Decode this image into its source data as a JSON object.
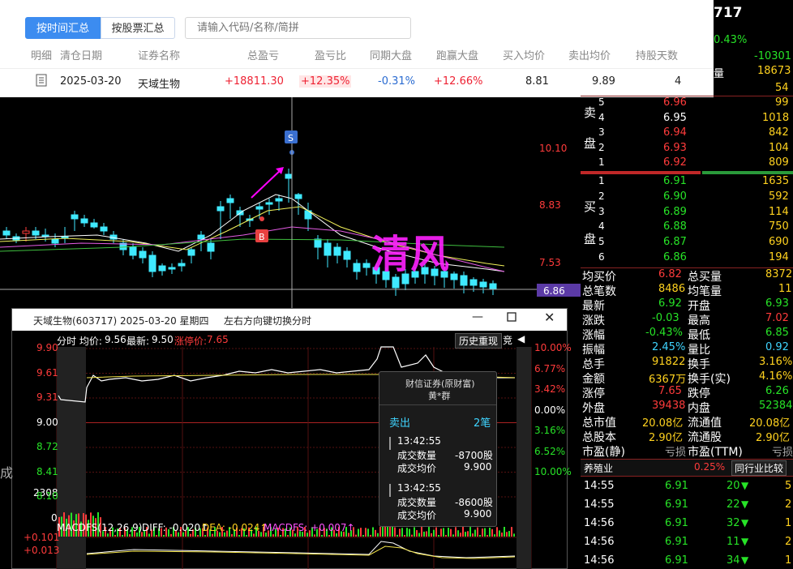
{
  "summary": {
    "tab_by_time": "按时间汇总",
    "tab_by_stock": "按股票汇总",
    "search_placeholder": "请输入代码/名称/简拼",
    "headers": [
      "明细",
      "清仓日期",
      "证券名称",
      "总盈亏",
      "盈亏比",
      "同期大盘",
      "跑赢大盘",
      "买入均价",
      "卖出均价",
      "持股天数"
    ],
    "row": {
      "date": "2025-03-20",
      "name": "天域生物",
      "total_pl": "+18811.30",
      "pl_ratio": "+12.35%",
      "market": "-0.31%",
      "beat": "+12.66%",
      "buy_avg": "8.81",
      "sell_avg": "9.89",
      "days": "4"
    }
  },
  "kline": {
    "price_labels": [
      "10.10",
      "8.83",
      "7.53"
    ],
    "current_price": "6.86",
    "marker_s": "S",
    "marker_b": "B",
    "watermark": "清风",
    "colors": {
      "up": "#ff3b3b",
      "down": "#3fe9ff",
      "ma5": "#ffffff",
      "ma10": "#f2f25a",
      "ma20": "#e65ce6",
      "ma60": "#3fbf3f",
      "accent": "#ff00ff"
    }
  },
  "quote": {
    "code_partial": "717",
    "change_partial": "0.43%",
    "vol_row1": "-10301",
    "vol_row2": "18673",
    "vol_label": "量",
    "vol_row3": "54",
    "sell_label": [
      "卖",
      "盘"
    ],
    "buy_label": [
      "买",
      "盘"
    ],
    "asks": [
      {
        "level": "5",
        "price": "6.96",
        "vol": "99"
      },
      {
        "level": "4",
        "price": "6.95",
        "vol": "1018"
      },
      {
        "level": "3",
        "price": "6.94",
        "vol": "842"
      },
      {
        "level": "2",
        "price": "6.93",
        "vol": "104"
      },
      {
        "level": "1",
        "price": "6.92",
        "vol": "809"
      }
    ],
    "bids": [
      {
        "level": "1",
        "price": "6.91",
        "vol": "1635"
      },
      {
        "level": "2",
        "price": "6.90",
        "vol": "592"
      },
      {
        "level": "3",
        "price": "6.89",
        "vol": "114"
      },
      {
        "level": "4",
        "price": "6.88",
        "vol": "750"
      },
      {
        "level": "5",
        "price": "6.87",
        "vol": "690"
      },
      {
        "level": "6",
        "price": "6.86",
        "vol": "194"
      }
    ],
    "stats": [
      {
        "l1": "均买价",
        "v1": "6.82",
        "c1": "red",
        "l2": "总买量",
        "v2": "8372",
        "c2": "yellow"
      },
      {
        "l1": "总笔数",
        "v1": "8486",
        "c1": "yellow",
        "l2": "均笔量",
        "v2": "11",
        "c2": "yellow"
      },
      {
        "l1": "最新",
        "v1": "6.92",
        "c1": "green",
        "l2": "开盘",
        "v2": "6.93",
        "c2": "green"
      },
      {
        "l1": "涨跌",
        "v1": "-0.03",
        "c1": "green",
        "l2": "最高",
        "v2": "7.02",
        "c2": "red"
      },
      {
        "l1": "涨幅",
        "v1": "-0.43%",
        "c1": "green",
        "l2": "最低",
        "v2": "6.85",
        "c2": "green"
      },
      {
        "l1": "振幅",
        "v1": "2.45%",
        "c1": "cyan",
        "l2": "量比",
        "v2": "0.92",
        "c2": "cyan"
      },
      {
        "l1": "总手",
        "v1": "91822",
        "c1": "yellow",
        "l2": "换手",
        "v2": "3.16%",
        "c2": "yellow"
      },
      {
        "l1": "金额",
        "v1": "6367万",
        "c1": "yellow",
        "l2": "换手(实)",
        "v2": "4.16%",
        "c2": "yellow"
      },
      {
        "l1": "涨停",
        "v1": "7.65",
        "c1": "red",
        "l2": "跌停",
        "v2": "6.26",
        "c2": "green"
      },
      {
        "l1": "外盘",
        "v1": "39438",
        "c1": "red",
        "l2": "内盘",
        "v2": "52384",
        "c2": "green"
      },
      {
        "l1": "总市值",
        "v1": "20.08亿",
        "c1": "yellow",
        "l2": "流通值",
        "v2": "20.08亿",
        "c2": "yellow"
      },
      {
        "l1": "总股本",
        "v1": "2.90亿",
        "c1": "yellow",
        "l2": "流通股",
        "v2": "2.90亿",
        "c2": "yellow"
      },
      {
        "l1": "市盈(静)",
        "v1": "亏损",
        "c1": "gray",
        "l2": "市盈(TTM)",
        "v2": "亏损",
        "c2": "gray"
      }
    ],
    "industry": "养殖业",
    "industry_change": "0.25%",
    "compare_btn": "同行业比较",
    "ticks": [
      {
        "time": "14:55",
        "price": "6.91",
        "vol": "20",
        "n": "5"
      },
      {
        "time": "14:55",
        "price": "6.91",
        "vol": "22",
        "n": "2"
      },
      {
        "time": "14:56",
        "price": "6.91",
        "vol": "32",
        "n": "1"
      },
      {
        "time": "14:56",
        "price": "6.91",
        "vol": "11",
        "n": "2"
      },
      {
        "time": "14:56",
        "price": "6.91",
        "vol": "34",
        "n": "1"
      }
    ]
  },
  "popup": {
    "title": "天域生物(603717) 2025-03-20 星期四",
    "hint": "左右方向键切换分时",
    "info_label": "分时 均价:",
    "avg_price": "9.56",
    "latest_label": "最新:",
    "latest": "9.50",
    "limit_label": "涨停价:",
    "limit": "7.65",
    "replay_btn": "历史重现",
    "bid_btn": "竞",
    "left_axis": [
      "9.90",
      "9.61",
      "9.31",
      "9.00",
      "8.72",
      "8.41",
      "8.10"
    ],
    "right_axis": [
      "10.00%",
      "6.77%",
      "3.42%",
      "0.00%",
      "3.16%",
      "6.52%",
      "10.00%"
    ],
    "vol_axis": [
      "2308",
      "0"
    ],
    "macd_label": "MACDFS(12,26,9)",
    "macd_diff": "DIFF: -0.020↑",
    "macd_dea": "DEA: -0.024↑",
    "macd_fs": "MACDFS: +0.007↑",
    "macd_axis": [
      "+0.101",
      "+0.013"
    ],
    "left_partial": "成"
  },
  "tooltip": {
    "broker": "财信证券(原财富)",
    "trader": "黄*群",
    "action": "卖出",
    "count": "2笔",
    "trades": [
      {
        "time": "13:42:55",
        "qty_label": "成交数量",
        "qty": "-8700股",
        "price_label": "成交均价",
        "price": "9.900"
      },
      {
        "time": "13:42:55",
        "qty_label": "成交数量",
        "qty": "-8600股",
        "price_label": "成交均价",
        "price": "9.900"
      }
    ]
  }
}
